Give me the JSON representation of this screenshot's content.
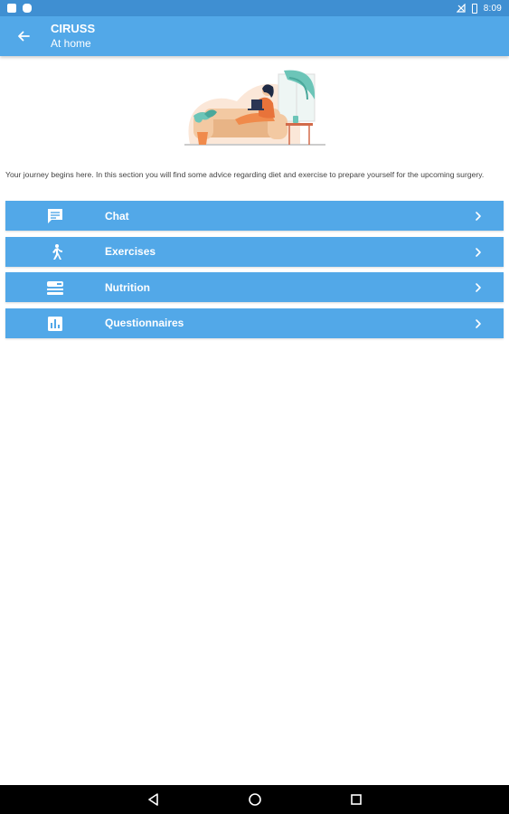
{
  "status_bar": {
    "time": "8:09",
    "icons": [
      "sd-card-icon",
      "notification-icon",
      "signal-off-icon",
      "battery-icon"
    ]
  },
  "app_bar": {
    "title": "CIRUSS",
    "subtitle": "At home",
    "back_icon": "arrow-back-icon"
  },
  "hero": {
    "image": "woman-on-sofa-with-laptop-illustration"
  },
  "intro_text": "Your journey begins here. In this section you will find some advice regarding diet and exercise to prepare yourself for the upcoming surgery.",
  "menu": {
    "items": [
      {
        "label": "Chat",
        "icon": "chat-icon"
      },
      {
        "label": "Exercises",
        "icon": "walking-icon"
      },
      {
        "label": "Nutrition",
        "icon": "food-tray-icon"
      },
      {
        "label": "Questionnaires",
        "icon": "bar-chart-icon"
      }
    ]
  },
  "nav_bar": {
    "buttons": [
      "back-triangle-icon",
      "home-circle-icon",
      "recents-square-icon"
    ]
  },
  "colors": {
    "status_bar": "#3f8fd2",
    "primary": "#52a8e8",
    "background": "#ffffff",
    "nav_bar": "#000000"
  }
}
